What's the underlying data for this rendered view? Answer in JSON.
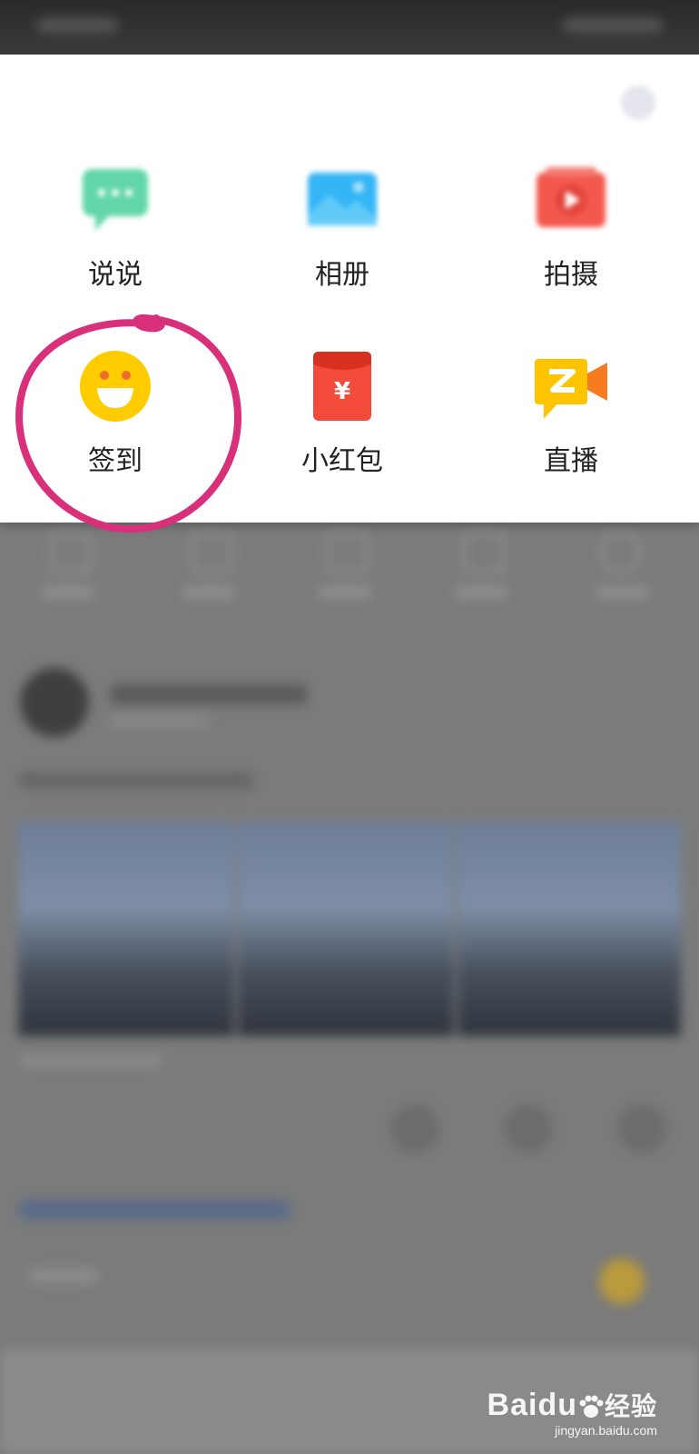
{
  "menu": {
    "items": [
      {
        "label": "说说",
        "icon": "speech-bubble-icon",
        "color": "#62d6a8"
      },
      {
        "label": "相册",
        "icon": "photo-album-icon",
        "color": "#35b5f5"
      },
      {
        "label": "拍摄",
        "icon": "video-camera-icon",
        "color": "#f2584c"
      },
      {
        "label": "签到",
        "icon": "smiley-face-icon",
        "color": "#ffcc00"
      },
      {
        "label": "小红包",
        "icon": "red-envelope-icon",
        "color": "#f24a3b"
      },
      {
        "label": "直播",
        "icon": "live-stream-icon",
        "color": "#ffc400"
      }
    ]
  },
  "annotation": {
    "color": "#d8307a"
  },
  "watermark": {
    "main": "Baidu",
    "suffix": "经验",
    "sub": "jingyan.baidu.com"
  }
}
